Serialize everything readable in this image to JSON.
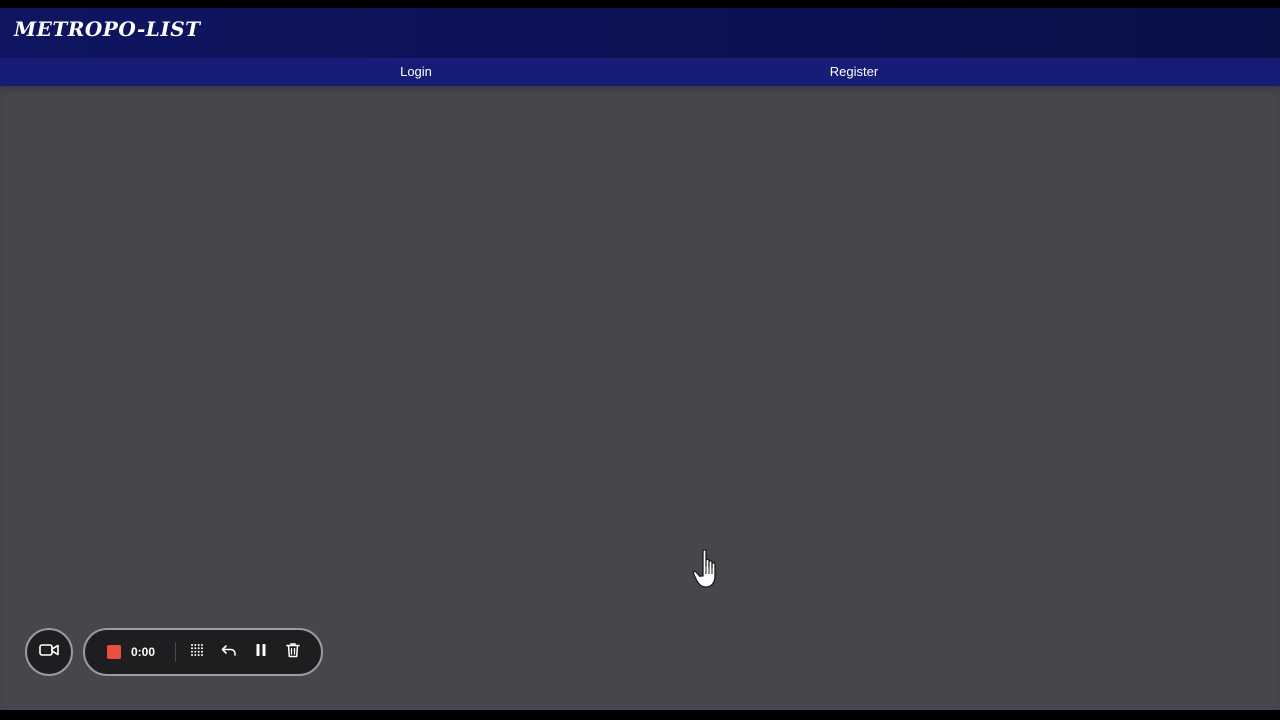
{
  "header": {
    "brand": "METROPO-LIST"
  },
  "nav": {
    "items": [
      {
        "label": "Login"
      },
      {
        "label": "Register"
      }
    ]
  },
  "recorder": {
    "timer": "0:00",
    "stop_color": "#e9513f",
    "icons": [
      "video-camera-icon",
      "stop-icon",
      "grid-icon",
      "undo-icon",
      "pause-icon",
      "trash-icon"
    ]
  },
  "colors": {
    "header_bg": "#0b1255",
    "nav_bg": "#171c76",
    "page_bg": "#46474c"
  }
}
